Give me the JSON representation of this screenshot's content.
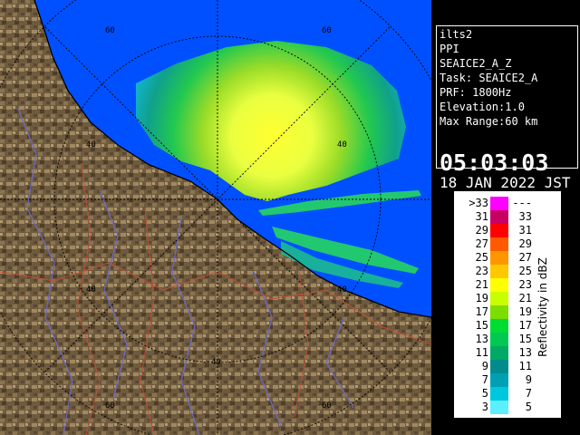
{
  "map": {
    "range_ring_labels": [
      "60",
      "60",
      "40",
      "40",
      "40",
      "40",
      "40",
      "60",
      "60"
    ]
  },
  "info": {
    "lines": [
      "ilts2",
      "PPI",
      "SEAICE2_A_Z",
      "Task: SEAICE2_A",
      "PRF: 1800Hz",
      "Elevation:1.0",
      "Max Range:60 km"
    ],
    "time": "05:03:03",
    "date": "18 JAN 2022 JST"
  },
  "legend": {
    "unit": "Reflectivity in dBZ",
    "rows": [
      {
        "left": ">33",
        "right": "---",
        "color": "#ff00ff"
      },
      {
        "left": "31",
        "right": "33",
        "color": "#c80064"
      },
      {
        "left": "29",
        "right": "31",
        "color": "#ff0000"
      },
      {
        "left": "27",
        "right": "29",
        "color": "#ff5a00"
      },
      {
        "left": "25",
        "right": "27",
        "color": "#ff9600"
      },
      {
        "left": "23",
        "right": "25",
        "color": "#ffc800"
      },
      {
        "left": "21",
        "right": "23",
        "color": "#ffff00"
      },
      {
        "left": "19",
        "right": "21",
        "color": "#c8ff00"
      },
      {
        "left": "17",
        "right": "19",
        "color": "#7ddc00"
      },
      {
        "left": "15",
        "right": "17",
        "color": "#00dc32"
      },
      {
        "left": "13",
        "right": "15",
        "color": "#00c850"
      },
      {
        "left": "11",
        "right": "13",
        "color": "#00aa64"
      },
      {
        "left": "9",
        "right": "11",
        "color": "#008c8c"
      },
      {
        "left": "7",
        "right": "9",
        "color": "#00a0b4"
      },
      {
        "left": "5",
        "right": "7",
        "color": "#00c8dc"
      },
      {
        "left": "3",
        "right": "5",
        "color": "#5af0ff"
      }
    ]
  }
}
